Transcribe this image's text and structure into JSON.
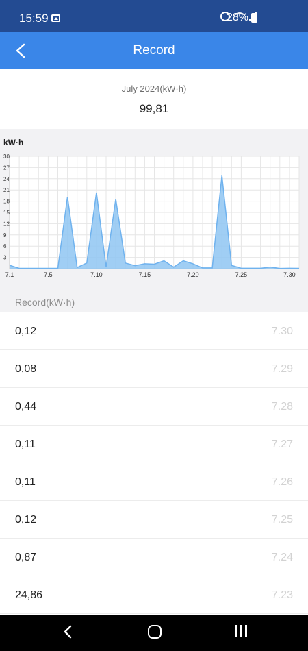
{
  "status_bar": {
    "time": "15:59",
    "battery": "28%",
    "icons": [
      "gallery-icon",
      "alarm-icon",
      "wifi-icon",
      "signal-icon",
      "battery-icon"
    ]
  },
  "header": {
    "title": "Record",
    "back_icon": "chevron-left-icon"
  },
  "summary": {
    "label": "July 2024(kW·h)",
    "value": "99,81"
  },
  "chart_data": {
    "type": "area",
    "ylabel": "kW·h",
    "ylim": [
      0,
      30
    ],
    "yticks": [
      "3",
      "6",
      "9",
      "12",
      "15",
      "18",
      "21",
      "24",
      "27",
      "30"
    ],
    "xticks": [
      "7.1",
      "7.5",
      "7.10",
      "7.15",
      "7.20",
      "7.25",
      "7.30"
    ],
    "color": "#8fc5f2",
    "line_color": "#6fb2ee",
    "grid": true,
    "days": [
      1,
      2,
      3,
      4,
      5,
      6,
      7,
      8,
      9,
      10,
      11,
      12,
      13,
      14,
      15,
      16,
      17,
      18,
      19,
      20,
      21,
      22,
      23,
      24,
      25,
      26,
      27,
      28,
      29,
      30,
      31
    ],
    "values": [
      0.9,
      0.1,
      0.1,
      0.1,
      0.1,
      0.1,
      19.2,
      0.3,
      1.5,
      20.3,
      0.4,
      18.6,
      1.5,
      0.8,
      1.3,
      1.2,
      2.1,
      0.4,
      2.1,
      1.3,
      0.2,
      0.2,
      24.86,
      0.87,
      0.12,
      0.11,
      0.11,
      0.44,
      0.08,
      0.12,
      0.1
    ]
  },
  "records": {
    "heading": "Record(kW·h)",
    "rows": [
      {
        "value": "0,12",
        "date": "7.30"
      },
      {
        "value": "0,08",
        "date": "7.29"
      },
      {
        "value": "0,44",
        "date": "7.28"
      },
      {
        "value": "0,11",
        "date": "7.27"
      },
      {
        "value": "0,11",
        "date": "7.26"
      },
      {
        "value": "0,12",
        "date": "7.25"
      },
      {
        "value": "0,87",
        "date": "7.24"
      },
      {
        "value": "24,86",
        "date": "7.23"
      }
    ]
  },
  "nav_bar": {
    "icons": [
      "nav-back-icon",
      "nav-home-icon",
      "nav-recents-icon"
    ]
  }
}
